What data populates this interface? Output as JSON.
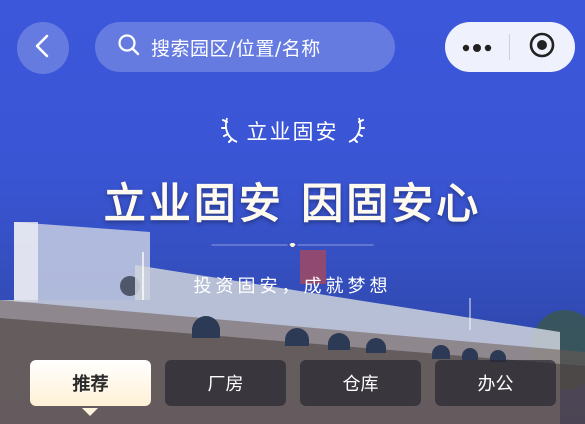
{
  "topbar": {
    "back_icon": "chevron-left-icon",
    "search_icon": "search-icon",
    "search_placeholder": "搜索园区/位置/名称",
    "more_icon": "more-dots-icon",
    "target_icon": "target-icon"
  },
  "banner": {
    "badge": "立业固安",
    "headline": "立业固安 因固安心",
    "subline": "投资固安，成就梦想"
  },
  "tabs": [
    {
      "label": "推荐",
      "active": true
    },
    {
      "label": "厂房",
      "active": false
    },
    {
      "label": "仓库",
      "active": false
    },
    {
      "label": "办公",
      "active": false
    }
  ]
}
